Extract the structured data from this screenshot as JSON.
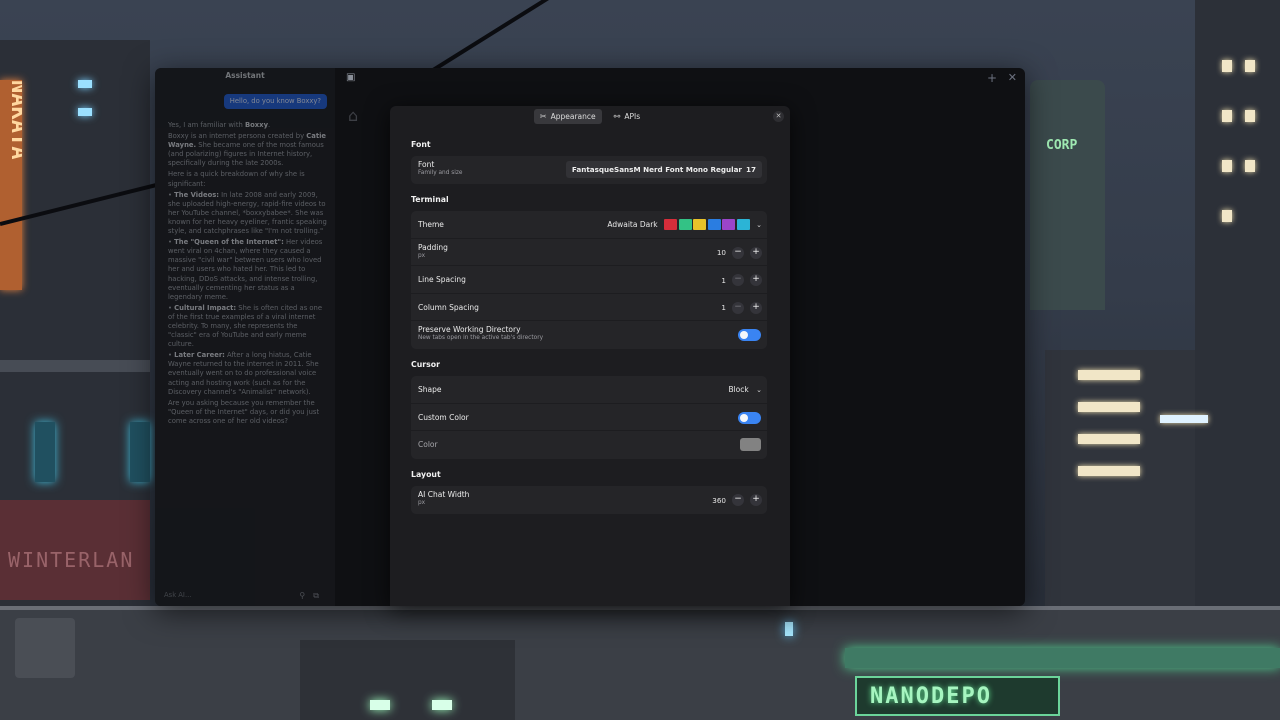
{
  "assistant": {
    "title": "Assistant",
    "user_message": "Hello, do you know Boxxy?",
    "reply": [
      {
        "pre": "Yes, I am familiar with ",
        "bold": "Boxxy",
        "post": "."
      },
      {
        "pre": "Boxxy is an internet persona created by ",
        "bold": "Catie Wayne.",
        "post": " She became one of the most famous (and polarizing) figures in Internet history, specifically during the late 2000s."
      },
      {
        "pre": "Here is a quick breakdown of why she is significant:",
        "bold": "",
        "post": ""
      },
      {
        "pre": "•  ",
        "bold": "The Videos:",
        "post": " In late 2008 and early 2009, she uploaded high-energy, rapid-fire videos to her YouTube channel, *boxxybabee*. She was known for her heavy eyeliner, frantic speaking style, and catchphrases like \"I'm not trolling.\""
      },
      {
        "pre": "•  ",
        "bold": "The \"Queen of the Internet\":",
        "post": " Her videos went viral on 4chan, where they caused a massive \"civil war\" between users who loved her and users who hated her. This led to hacking, DDoS attacks, and intense trolling, eventually cementing her status as a legendary meme."
      },
      {
        "pre": "•  ",
        "bold": "Cultural Impact:",
        "post": " She is often cited as one of the first true examples of a viral internet celebrity. To many, she represents the \"classic\" era of YouTube and early meme culture."
      },
      {
        "pre": "•  ",
        "bold": "Later Career:",
        "post": " After a long hiatus, Catie Wayne returned to the internet in 2011. She eventually went on to do professional voice acting and hosting work (such as for the Discovery channel's \"Animalist\" network)."
      },
      {
        "pre": "Are you asking because you remember the \"Queen of the Internet\" days, or did you just come across one of her old videos?",
        "bold": "",
        "post": ""
      }
    ],
    "input_placeholder": "Ask AI..."
  },
  "dialog": {
    "tabs": [
      {
        "label": "Appearance",
        "icon": "paintbrush-icon",
        "active": true
      },
      {
        "label": "APIs",
        "icon": "api-icon",
        "active": false
      }
    ],
    "sections": {
      "font": {
        "title": "Font",
        "font_label": "Font",
        "font_sub": "Family and size",
        "font_name": "FantasqueSansM Nerd Font Mono Regular",
        "font_size": "17"
      },
      "terminal": {
        "title": "Terminal",
        "theme_label": "Theme",
        "theme_name": "Adwaita Dark",
        "theme_swatches": [
          "#d62d3a",
          "#33c285",
          "#e8c22a",
          "#2a7de1",
          "#9b45c9",
          "#2bb4d6"
        ],
        "padding_label": "Padding",
        "padding_sub": "px",
        "padding_value": "10",
        "line_spacing_label": "Line Spacing",
        "line_spacing_value": "1",
        "column_spacing_label": "Column Spacing",
        "column_spacing_value": "1",
        "preserve_label": "Preserve Working Directory",
        "preserve_sub": "New tabs open in the active tab's directory",
        "preserve_on": true
      },
      "cursor": {
        "title": "Cursor",
        "shape_label": "Shape",
        "shape_value": "Block",
        "custom_color_label": "Custom Color",
        "custom_color_on": true,
        "color_label": "Color",
        "color_value": "#828282"
      },
      "layout": {
        "title": "Layout",
        "chat_width_label": "AI Chat Width",
        "chat_width_sub": "px",
        "chat_width_value": "360"
      }
    }
  },
  "background_signs": {
    "corp": "CORP",
    "nanodepo": "NANODEPO",
    "winterland": "WINTERLAN",
    "nakata": "NAKATA"
  }
}
